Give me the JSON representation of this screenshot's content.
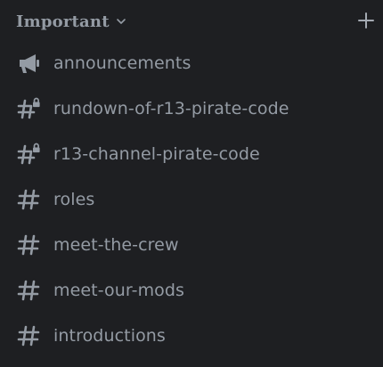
{
  "category": {
    "name": "Important",
    "collapse_icon": "chevron-down-icon",
    "add_icon": "plus-icon"
  },
  "channels": [
    {
      "label": "announcements",
      "icon": "megaphone-icon"
    },
    {
      "label": "rundown-of-r13-pirate-code",
      "icon": "hash-lock-icon"
    },
    {
      "label": "r13-channel-pirate-code",
      "icon": "hash-lock-icon"
    },
    {
      "label": "roles",
      "icon": "hash-icon"
    },
    {
      "label": "meet-the-crew",
      "icon": "hash-icon"
    },
    {
      "label": "meet-our-mods",
      "icon": "hash-icon"
    },
    {
      "label": "introductions",
      "icon": "hash-icon"
    }
  ],
  "colors": {
    "background": "#1e1f22",
    "muted_text": "#949ba4"
  }
}
